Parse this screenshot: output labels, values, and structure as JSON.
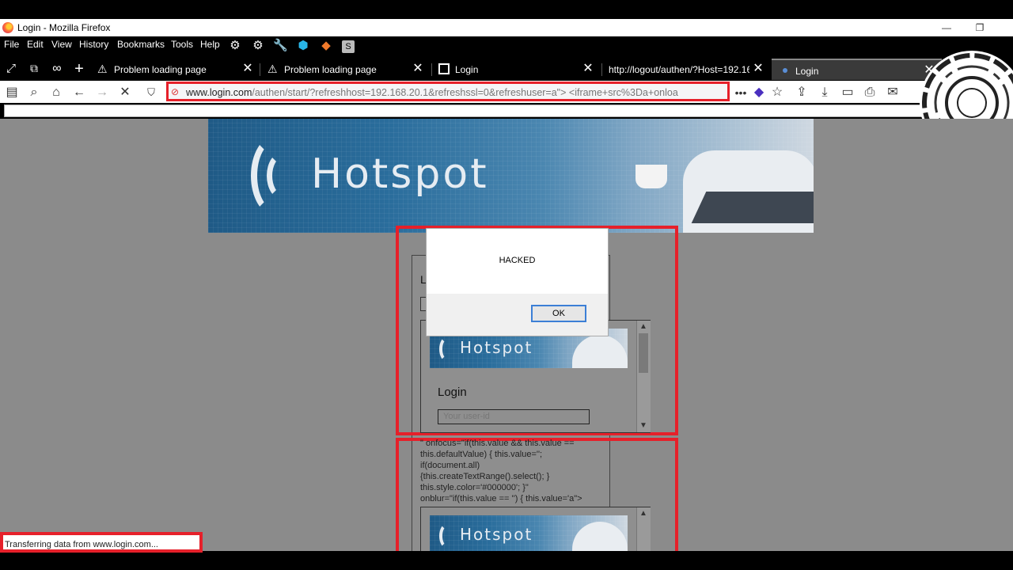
{
  "window": {
    "title": "Login - Mozilla Firefox",
    "controls": [
      "—",
      "❐"
    ]
  },
  "menubar": {
    "items": [
      "File",
      "Edit",
      "View",
      "History",
      "Bookmarks",
      "Tools",
      "Help"
    ]
  },
  "tabs": [
    {
      "label": "Problem loading page",
      "icon": "warning-icon"
    },
    {
      "label": "Problem loading page",
      "icon": "warning-icon"
    },
    {
      "label": "Login",
      "icon": "page-icon"
    },
    {
      "label": "http://logout/authen/?Host=192.16",
      "icon": "none"
    },
    {
      "label": "Login",
      "icon": "loading-dot",
      "active": true
    }
  ],
  "nav": {
    "url_domain": "www.login.com",
    "url_path": "/authen/start/?refreshhost=192.168.20.1&refreshssl=0&refreshuser=a\"> <iframe+src%3Da+onloa"
  },
  "page": {
    "banner_word": "Hotspot",
    "form_label_fragment": "L",
    "inner_login_heading": "Login",
    "inner_input_placeholder": "Your user-id",
    "injected_source": "\" onfocus=\"if(this.value && this.value ==\nthis.defaultValue) { this.value='';\nif(document.all)\n{this.createTextRange().select(); }\nthis.style.color='#000000'; }\"\nonblur=\"if(this.value == '') { this.value='a\">"
  },
  "dialog": {
    "message": "HACKED",
    "ok_label": "OK"
  },
  "statusbar": {
    "text": "Transferring data from www.login.com..."
  },
  "colors": {
    "highlight_red": "#e6202a",
    "dialog_ok_border": "#3c7fd6",
    "page_gray": "#8b8b8b"
  }
}
